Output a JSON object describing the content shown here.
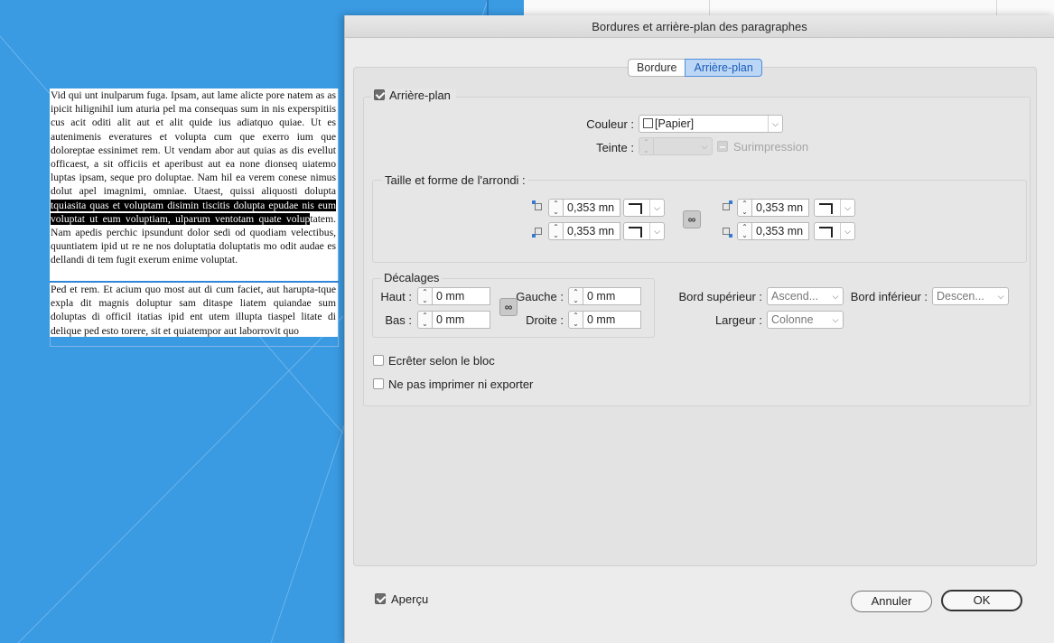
{
  "document": {
    "paragraph1": {
      "before": "Vid qui unt inulparum fuga. Ipsam, aut lame alicte pore natem as as ipicit hilignihil ium aturia pel ma consequas sum in nis experspitiis cus acit oditi alit aut et alit quide ius adiatquo quiae. Ut es autenimenis everatures et volupta cum que exerro ium que doloreptae essinimet rem. Ut vendam abor aut quias as dis evellut officaest, a sit officiis et aperibust aut ea none dionseq uiatemo luptas ipsam, seque pro doluptae. Nam hil ea verem conese nimus dolut apel imagnimi, omniae. Utaest, quissi aliquosti dolupta",
      "selected": " tquiasita quas et voluptam disimin tiscitis dolupta epudae nis eum voluptat ut eum voluptiam, ulparum ventotam quate volup",
      "after": "tatem. Nam apedis perchic ipsundunt dolor sedi od quodiam velectibus, quuntiatem ipid ut re ne nos doluptatia doluptatis mo odit audae es dellandi di tem fugit exerum enime voluptat."
    },
    "paragraph2": "Ped et rem. Et acium quo most aut di cum faciet, aut harupta-tque expla dit magnis doluptur sam ditaspe liatem quiandae sum doluptas di officil itatias ipid ent utem illupta tiaspel litate di delique ped esto torere, sit et quiatempor aut laborrovit quo"
  },
  "dialog": {
    "title": "Bordures et arrière-plan des paragraphes",
    "tabs": [
      {
        "label": "Bordure",
        "active": false
      },
      {
        "label": "Arrière-plan",
        "active": true
      }
    ],
    "background": {
      "enabled_label": "Arrière-plan",
      "enabled": true,
      "color_label": "Couleur :",
      "color_value": "[Papier]",
      "tint_label": "Teinte :",
      "tint_value": "",
      "overprint_label": "Surimpression"
    },
    "rounding": {
      "legend": "Taille et forme de l'arrondi :",
      "top_left": "0,353 mn",
      "bottom_left": "0,353 mn",
      "top_right": "0,353 mn",
      "bottom_right": "0,353 mn"
    },
    "offsets": {
      "legend": "Décalages",
      "top_label": "Haut :",
      "top_value": "0 mm",
      "bottom_label": "Bas :",
      "bottom_value": "0 mm",
      "left_label": "Gauche :",
      "left_value": "0 mm",
      "right_label": "Droite :",
      "right_value": "0 mm"
    },
    "edges": {
      "top_edge_label": "Bord supérieur :",
      "top_edge_value": "Ascend...",
      "bottom_edge_label": "Bord inférieur :",
      "bottom_edge_value": "Descen...",
      "width_label": "Largeur :",
      "width_value": "Colonne"
    },
    "clip_label": "Ecrêter selon le bloc",
    "no_print_label": "Ne pas imprimer ni exporter",
    "preview_label": "Aperçu",
    "cancel_label": "Annuler",
    "ok_label": "OK"
  },
  "colors": {
    "canvas_blue": "#3a9ae2",
    "active_tab": "#bcd6f5",
    "selection": "#000000"
  }
}
